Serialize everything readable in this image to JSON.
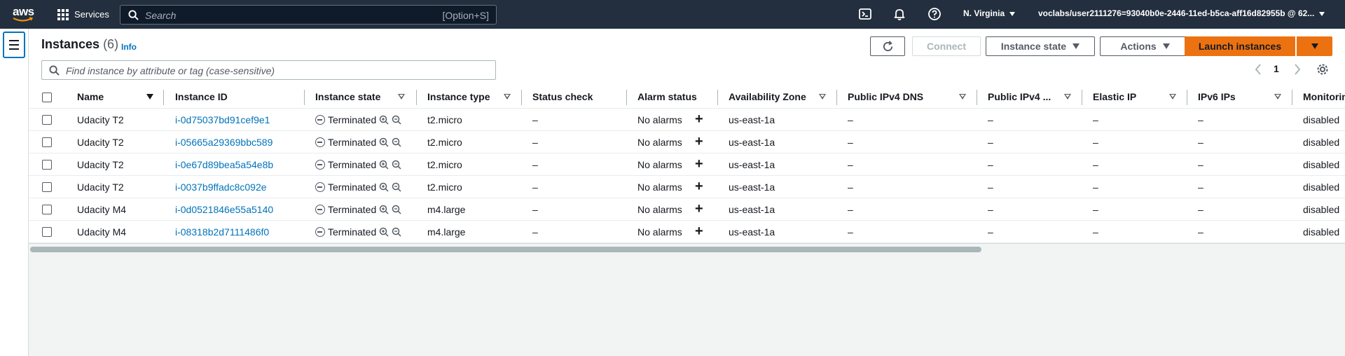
{
  "topnav": {
    "logo_text": "aws",
    "services_label": "Services",
    "search_placeholder": "Search",
    "search_shortcut": "[Option+S]",
    "icons": [
      "cloudshell-icon",
      "bell-icon",
      "help-icon"
    ],
    "region": "N. Virginia",
    "account": "voclabs/user2111276=93040b0e-2446-11ed-b5ca-aff16d82955b @ 62..."
  },
  "panel": {
    "title": "Instances",
    "count": "(6)",
    "info": "Info",
    "buttons": {
      "connect": "Connect",
      "instance_state": "Instance state",
      "actions": "Actions",
      "launch": "Launch instances"
    },
    "filter_placeholder": "Find instance by attribute or tag (case-sensitive)",
    "page": "1"
  },
  "table": {
    "columns": [
      "Name",
      "Instance ID",
      "Instance state",
      "Instance type",
      "Status check",
      "Alarm status",
      "Availability Zone",
      "Public IPv4 DNS",
      "Public IPv4 ...",
      "Elastic IP",
      "IPv6 IPs",
      "Monitoring"
    ],
    "rows": [
      {
        "name": "Udacity T2",
        "id": "i-0d75037bd91cef9e1",
        "state": "Terminated",
        "type": "t2.micro",
        "status": "–",
        "alarm": "No alarms",
        "az": "us-east-1a",
        "dns": "–",
        "ipv4": "–",
        "eip": "–",
        "ipv6": "–",
        "monitoring": "disabled"
      },
      {
        "name": "Udacity T2",
        "id": "i-05665a29369bbc589",
        "state": "Terminated",
        "type": "t2.micro",
        "status": "–",
        "alarm": "No alarms",
        "az": "us-east-1a",
        "dns": "–",
        "ipv4": "–",
        "eip": "–",
        "ipv6": "–",
        "monitoring": "disabled"
      },
      {
        "name": "Udacity T2",
        "id": "i-0e67d89bea5a54e8b",
        "state": "Terminated",
        "type": "t2.micro",
        "status": "–",
        "alarm": "No alarms",
        "az": "us-east-1a",
        "dns": "–",
        "ipv4": "–",
        "eip": "–",
        "ipv6": "–",
        "monitoring": "disabled"
      },
      {
        "name": "Udacity T2",
        "id": "i-0037b9ffadc8c092e",
        "state": "Terminated",
        "type": "t2.micro",
        "status": "–",
        "alarm": "No alarms",
        "az": "us-east-1a",
        "dns": "–",
        "ipv4": "–",
        "eip": "–",
        "ipv6": "–",
        "monitoring": "disabled"
      },
      {
        "name": "Udacity M4",
        "id": "i-0d0521846e55a5140",
        "state": "Terminated",
        "type": "m4.large",
        "status": "–",
        "alarm": "No alarms",
        "az": "us-east-1a",
        "dns": "–",
        "ipv4": "–",
        "eip": "–",
        "ipv6": "–",
        "monitoring": "disabled"
      },
      {
        "name": "Udacity M4",
        "id": "i-08318b2d7111486f0",
        "state": "Terminated",
        "type": "m4.large",
        "status": "–",
        "alarm": "No alarms",
        "az": "us-east-1a",
        "dns": "–",
        "ipv4": "–",
        "eip": "–",
        "ipv6": "–",
        "monitoring": "disabled"
      }
    ]
  },
  "colors": {
    "nav_bg": "#232f3e",
    "link": "#0073bb",
    "primary": "#ec7211"
  }
}
